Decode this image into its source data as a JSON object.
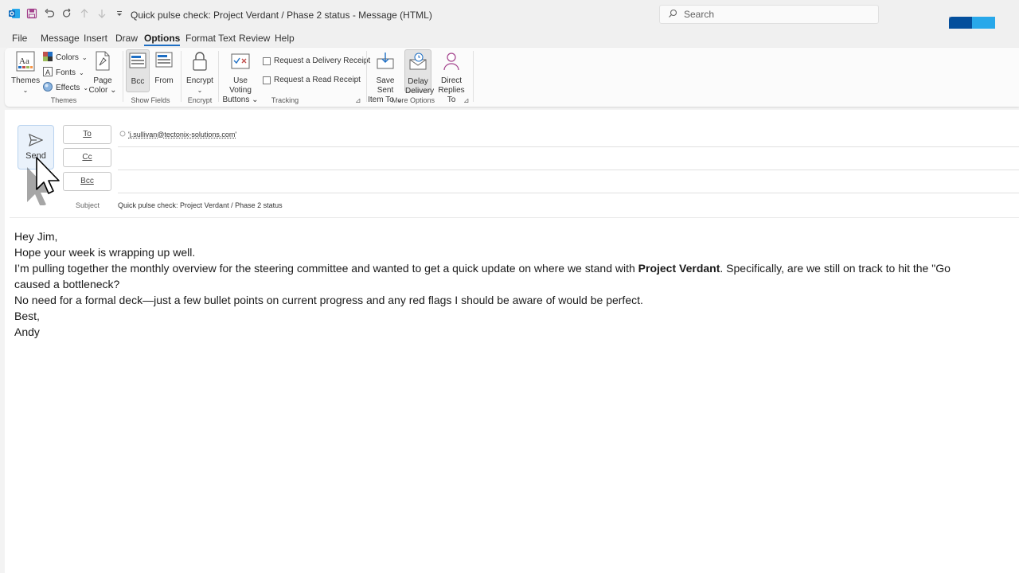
{
  "titlebar": {
    "window_title": "Quick pulse check: Project Verdant / Phase 2 status  -  Message (HTML)",
    "search_placeholder": "Search"
  },
  "menu": {
    "tabs": [
      {
        "label": "File"
      },
      {
        "label": "Message"
      },
      {
        "label": "Insert"
      },
      {
        "label": "Draw"
      },
      {
        "label": "Options",
        "active": true
      },
      {
        "label": "Format Text"
      },
      {
        "label": "Review"
      },
      {
        "label": "Help"
      }
    ]
  },
  "ribbon": {
    "themes_group": {
      "label": "Themes",
      "themes": "Themes",
      "colors": "Colors",
      "fonts": "Fonts",
      "effects": "Effects",
      "page_color_line1": "Page",
      "page_color_line2": "Color"
    },
    "show_fields_group": {
      "label": "Show Fields",
      "bcc": "Bcc",
      "from": "From"
    },
    "encrypt_group": {
      "label": "Encrypt",
      "encrypt": "Encrypt"
    },
    "tracking_group": {
      "label": "Tracking",
      "voting_line1": "Use Voting",
      "voting_line2": "Buttons",
      "delivery_receipt": "Request a Delivery Receipt",
      "read_receipt": "Request a Read Receipt"
    },
    "more_options_group": {
      "label": "More Options",
      "save_sent_line1": "Save Sent",
      "save_sent_line2": "Item To",
      "delay_line1": "Delay",
      "delay_line2": "Delivery",
      "direct_line1": "Direct",
      "direct_line2": "Replies To"
    }
  },
  "compose": {
    "send_label": "Send",
    "to_label": "To",
    "cc_label": "Cc",
    "bcc_label": "Bcc",
    "to_value": "'j.sullivan@tectonix-solutions.com'",
    "subject_label": "Subject",
    "subject_value": "Quick pulse check: Project Verdant / Phase 2 status"
  },
  "body": {
    "greeting": "Hey Jim,",
    "line1": "Hope your week is wrapping up well.",
    "line2_before": "I’m pulling together the monthly overview for the steering committee and wanted to get a quick update on where we stand with ",
    "line2_bold": "Project Verdant",
    "line2_after": ". Specifically, are we still on track to hit the \"Go",
    "line3": "caused a bottleneck?",
    "line4": "No need for a formal deck—just a few bullet points on current progress and any red flags I should be aware of would be perfect.",
    "signoff": "Best,",
    "name": "Andy"
  },
  "colors": {
    "accent": "#1f6fc4",
    "outlook_blue": "#0f78d4",
    "send_bg": "#eaf2fb"
  }
}
